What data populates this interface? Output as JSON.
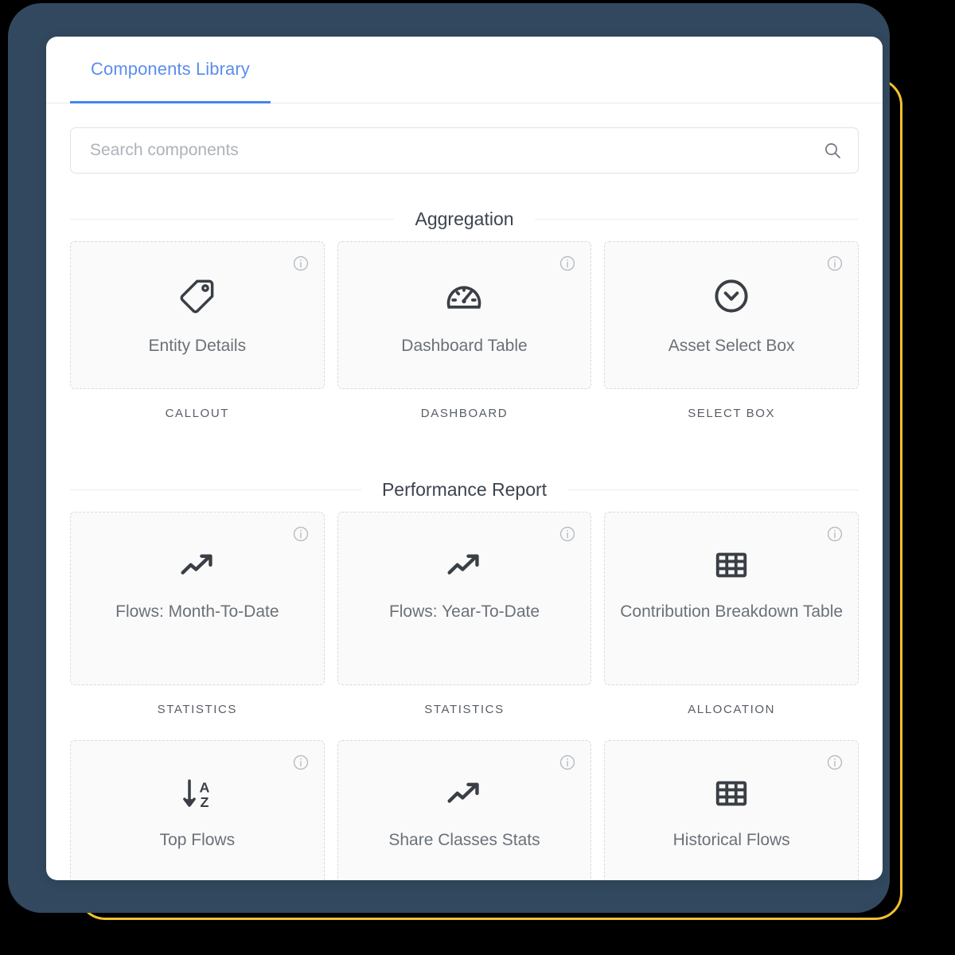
{
  "frame": {
    "background_color": "#000000",
    "navy_color": "#32485E",
    "accent_outline_color": "#F2C12E"
  },
  "tabs": [
    {
      "label": "Components Library",
      "active": true,
      "color": "#5B8DEF"
    }
  ],
  "search": {
    "placeholder": "Search components",
    "value": "",
    "icon": "search-icon"
  },
  "sections": [
    {
      "title": "Aggregation",
      "items": [
        {
          "title": "Entity Details",
          "caption": "CALLOUT",
          "icon": "tag-icon",
          "info": "i"
        },
        {
          "title": "Dashboard Table",
          "caption": "DASHBOARD",
          "icon": "gauge-icon",
          "info": "i"
        },
        {
          "title": "Asset Select Box",
          "caption": "SELECT BOX",
          "icon": "chevron-down-circle-icon",
          "info": "i"
        }
      ]
    },
    {
      "title": "Performance Report",
      "items": [
        {
          "title": "Flows: Month-To-Date",
          "caption": "STATISTICS",
          "icon": "trending-up-icon",
          "info": "i"
        },
        {
          "title": "Flows: Year-To-Date",
          "caption": "STATISTICS",
          "icon": "trending-up-icon",
          "info": "i"
        },
        {
          "title": "Contribution Breakdown Table",
          "caption": "ALLOCATION",
          "icon": "grid-table-icon",
          "info": "i"
        },
        {
          "title": "Top Flows",
          "caption": "",
          "icon": "sort-alpha-down-icon",
          "info": "i"
        },
        {
          "title": "Share Classes Stats",
          "caption": "",
          "icon": "trending-up-icon",
          "info": "i"
        },
        {
          "title": "Historical Flows",
          "caption": "",
          "icon": "grid-table-icon",
          "info": "i"
        }
      ]
    }
  ]
}
